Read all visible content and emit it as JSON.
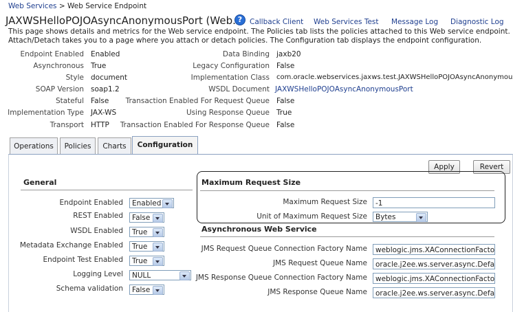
{
  "breadcrumb": {
    "parent": "Web Services",
    "separator": ">",
    "current": "Web Service Endpoint"
  },
  "page_title": "JAXWSHelloPOJOAsyncAnonymousPort (Web...",
  "top_links": [
    "Callback Client",
    "Web Services Test",
    "Message Log",
    "Diagnostic Log"
  ],
  "description": "This page shows details and metrics for the Web service endpoint. The Policies tab lists the policies attached to this Web service endpoint. Attach/Detach takes you to a page where you attach or detach policies. The Configuration tab displays the endpoint configuration.",
  "properties_left": [
    {
      "label": "Endpoint Enabled",
      "value": "Enabled"
    },
    {
      "label": "Asynchronous",
      "value": "True"
    },
    {
      "label": "Style",
      "value": "document"
    },
    {
      "label": "SOAP Version",
      "value": "soap1.2"
    },
    {
      "label": "Stateful",
      "value": "False"
    },
    {
      "label": "Implementation Type",
      "value": "JAX-WS"
    },
    {
      "label": "Transport",
      "value": "HTTP"
    }
  ],
  "properties_right": [
    {
      "label": "Data Binding",
      "value": "jaxb20"
    },
    {
      "label": "Legacy Configuration",
      "value": "False"
    },
    {
      "label": "Implementation Class",
      "value": "com.oracle.webservices.jaxws.test.JAXWSHelloPOJOAsyncAnonymous"
    },
    {
      "label": "WSDL Document",
      "value": "JAXWSHelloPOJOAsyncAnonymousPort"
    },
    {
      "label": "Transaction Enabled For Request Queue",
      "value": "False"
    },
    {
      "label": "Using Response Queue",
      "value": "True"
    },
    {
      "label": "Transaction Enabled For Response Queue",
      "value": "False"
    }
  ],
  "tabs": [
    "Operations",
    "Policies",
    "Charts",
    "Configuration"
  ],
  "buttons": {
    "apply": "Apply",
    "revert": "Revert"
  },
  "general": {
    "heading": "General",
    "fields": [
      {
        "label": "Endpoint Enabled",
        "value": "Enabled"
      },
      {
        "label": "REST Enabled",
        "value": "False"
      },
      {
        "label": "WSDL Enabled",
        "value": "True"
      },
      {
        "label": "Metadata Exchange Enabled",
        "value": "True"
      },
      {
        "label": "Endpoint Test Enabled",
        "value": "True"
      },
      {
        "label": "Logging Level",
        "value": "NULL"
      },
      {
        "label": "Schema validation",
        "value": "False"
      }
    ]
  },
  "max_request": {
    "heading": "Maximum Request Size",
    "size_label": "Maximum Request Size",
    "size_value": "-1",
    "unit_label": "Unit of Maximum Request Size",
    "unit_value": "Bytes"
  },
  "async": {
    "heading": "Asynchronous Web Service",
    "fields": [
      {
        "label": "JMS Request Queue Connection Factory Name",
        "value": "weblogic.jms.XAConnectionFactory"
      },
      {
        "label": "JMS Request Queue Name",
        "value": "oracle.j2ee.ws.server.async.Defau"
      },
      {
        "label": "JMS Response Queue Connection Factory Name",
        "value": "weblogic.jms.XAConnectionFactory"
      },
      {
        "label": "JMS Response Queue Name",
        "value": "oracle.j2ee.ws.server.async.Defau"
      }
    ]
  },
  "colors": {
    "link": "#1f3f8f",
    "tab_border": "#8aa0c0",
    "input_border": "#7f9db9"
  },
  "icons": [
    "help-icon",
    "dropdown-arrow-icon"
  ]
}
